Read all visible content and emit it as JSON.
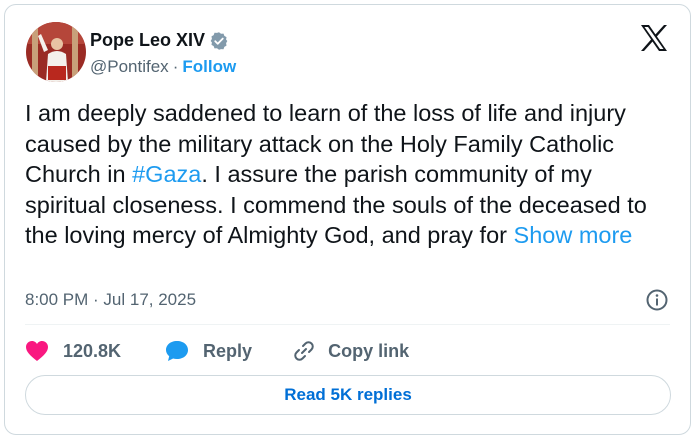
{
  "author": {
    "name": "Pope Leo XIV",
    "handle": "@Pontifex",
    "separator": "·",
    "follow_label": "Follow"
  },
  "tweet": {
    "text_before_link": "I am deeply saddened to learn of the loss of life and injury caused by the military attack on the Holy Family Catholic Church in ",
    "hashtag": "#Gaza",
    "text_after_link": ". I assure the parish community of my spiritual closeness. I commend the souls of the deceased to the loving mercy of Almighty God, and pray for ",
    "show_more": "Show more"
  },
  "meta": {
    "timestamp": "8:00 PM · Jul 17, 2025"
  },
  "actions": {
    "likes": "120.8K",
    "reply_label": "Reply",
    "copy_link_label": "Copy link"
  },
  "read_replies_label": "Read 5K replies",
  "icons": {
    "verified": "verified-badge-icon",
    "x_logo": "x-logo-icon",
    "info": "info-icon",
    "heart": "heart-icon",
    "reply": "speech-bubble-icon",
    "link": "link-icon"
  },
  "colors": {
    "accent": "#1d9bf0",
    "heart": "#f91880",
    "text": "#0f1419",
    "muted": "#536471"
  }
}
